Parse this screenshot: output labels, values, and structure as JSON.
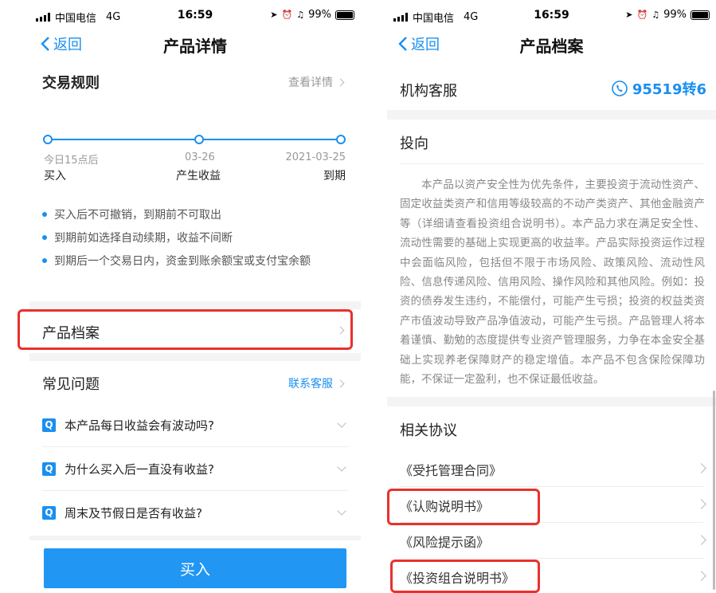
{
  "status": {
    "carrier": "中国电信",
    "network": "4G",
    "time": "16:59",
    "battery": "99%"
  },
  "left": {
    "back_label": "返回",
    "title": "产品详情",
    "trade_rules": {
      "heading": "交易规则",
      "detail_link": "查看详情"
    },
    "timeline": [
      {
        "date": "今日15点后",
        "label": "买入"
      },
      {
        "date": "03-26",
        "label": "产生收益"
      },
      {
        "date": "2021-03-25",
        "label": "到期"
      }
    ],
    "bullets": [
      "买入后不可撤销，到期前不可取出",
      "到期前如选择自动续期，收益不间断",
      "到期后一个交易日内，资金到账余额宝或支付宝余额"
    ],
    "archive_label": "产品档案",
    "faq": {
      "heading": "常见问题",
      "contact_link": "联系客服",
      "badge": "Q",
      "questions": [
        "本产品每日收益会有波动吗?",
        "为什么买入后一直没有收益?",
        "周末及节假日是否有收益?"
      ]
    },
    "buy_label": "买入"
  },
  "right": {
    "back_label": "返回",
    "title": "产品档案",
    "service": {
      "label": "机构客服",
      "phone": "95519转6"
    },
    "invest": {
      "heading": "投向",
      "text": "本产品以资产安全性为优先条件，主要投资于流动性资产、固定收益类资产和信用等级较高的不动产类资产、其他金融资产等（详细请查看投资组合说明书）。本产品力求在满足安全性、流动性需要的基础上实现更高的收益率。产品实际投资运作过程中会面临风险，包括但不限于市场风险、政策风险、流动性风险、信息传递风险、信用风险、操作风险和其他风险。例如：投资的债券发生违约，不能偿付，可能产生亏损；投资的权益类资产市值波动导致产品净值波动，可能产生亏损。产品管理人将本着谨慎、勤勉的态度提供专业资产管理服务，力争在本金安全基础上实现养老保障财产的稳定增值。本产品不包含保险保障功能，不保证一定盈利，也不保证最低收益。"
    },
    "agreements": {
      "heading": "相关协议",
      "items": [
        "《受托管理合同》",
        "《认购说明书》",
        "《风险提示函》",
        "《投资组合说明书》"
      ]
    }
  },
  "colors": {
    "accent": "#1a8ff0",
    "button": "#2196f3",
    "highlight": "#e8312c"
  }
}
